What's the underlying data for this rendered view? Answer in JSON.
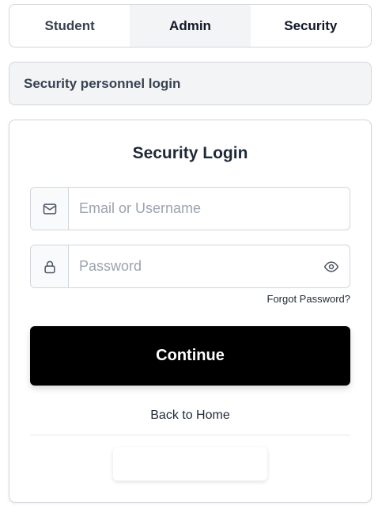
{
  "tabs": [
    {
      "label": "Student"
    },
    {
      "label": "Admin"
    },
    {
      "label": "Security"
    }
  ],
  "banner": {
    "text": "Security personnel login"
  },
  "login": {
    "title": "Security Login",
    "email_placeholder": "Email or Username",
    "password_placeholder": "Password",
    "forgot_label": "Forgot Password?",
    "continue_label": "Continue",
    "back_label": "Back to Home"
  },
  "icons": {
    "email": "mail-icon",
    "password": "lock-icon",
    "toggle": "eye-icon"
  },
  "colors": {
    "primary_button": "#000000",
    "hover_tab_bg": "#f3f4f6",
    "banner_bg": "#f3f4f6"
  }
}
